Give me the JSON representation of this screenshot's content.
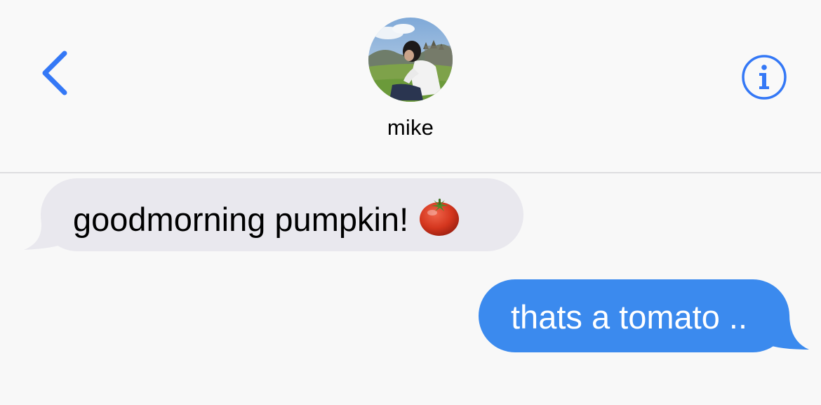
{
  "header": {
    "contact_name": "mike",
    "back_icon": "chevron-left-icon",
    "info_icon": "info-icon",
    "accent_color": "#3478f6"
  },
  "messages": [
    {
      "direction": "incoming",
      "text": "goodmorning pumpkin!",
      "emoji": "tomato-icon",
      "bubble_color": "#e9e8ee",
      "text_color": "#000000"
    },
    {
      "direction": "outgoing",
      "text": "thats a tomato ..",
      "bubble_color": "#3b8aee",
      "text_color": "#ffffff"
    }
  ]
}
